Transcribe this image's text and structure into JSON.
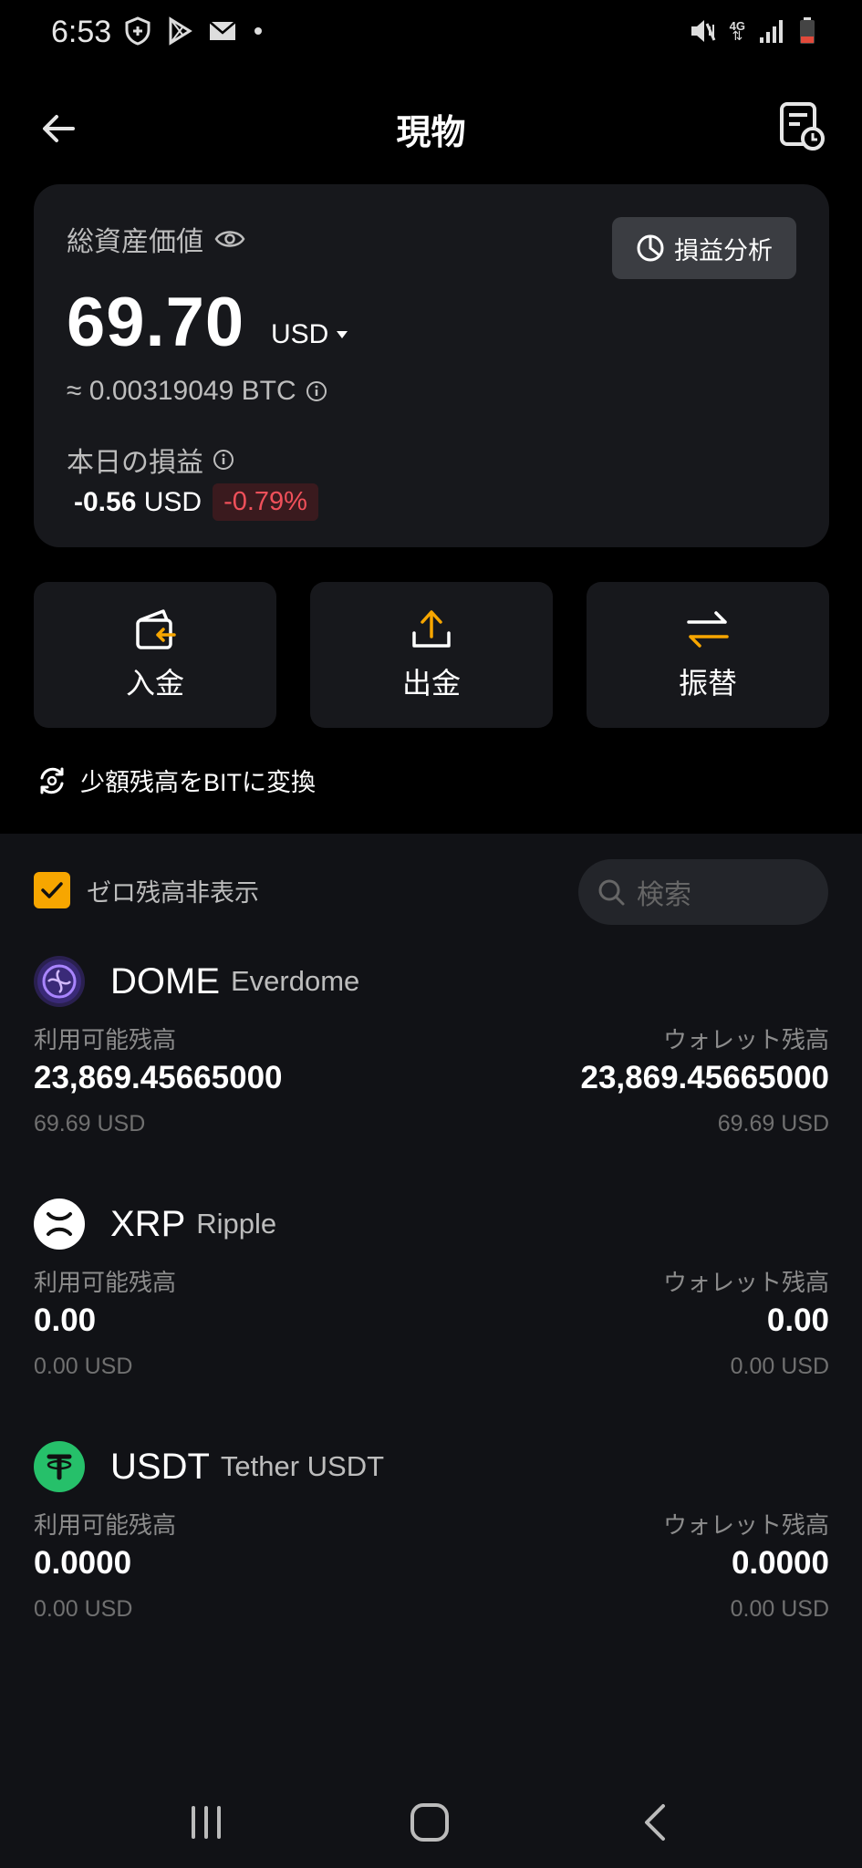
{
  "status": {
    "time": "6:53",
    "network": "4G"
  },
  "header": {
    "title": "現物"
  },
  "card": {
    "total_label": "総資産価値",
    "pnl_button": "損益分析",
    "amount": "69.70",
    "currency": "USD",
    "btc_equiv": "≈ 0.00319049 BTC",
    "today_label": "本日の損益",
    "today_value": "-0.56",
    "today_currency": "USD",
    "today_pct": "-0.79%"
  },
  "actions": {
    "deposit": "入金",
    "withdraw": "出金",
    "transfer": "振替"
  },
  "convert_label": "少額残高をBITに変換",
  "filter": {
    "hide_zero_label": "ゼロ残高非表示",
    "hide_zero_checked": true
  },
  "search": {
    "placeholder": "検索"
  },
  "coins": [
    {
      "symbol": "DOME",
      "name": "Everdome",
      "available_label": "利用可能残高",
      "wallet_label": "ウォレット残高",
      "available": "23,869.45665000",
      "available_usd": "69.69 USD",
      "wallet": "23,869.45665000",
      "wallet_usd": "69.69 USD"
    },
    {
      "symbol": "XRP",
      "name": "Ripple",
      "available_label": "利用可能残高",
      "wallet_label": "ウォレット残高",
      "available": "0.00",
      "available_usd": "0.00 USD",
      "wallet": "0.00",
      "wallet_usd": "0.00 USD"
    },
    {
      "symbol": "USDT",
      "name": "Tether USDT",
      "available_label": "利用可能残高",
      "wallet_label": "ウォレット残高",
      "available": "0.0000",
      "available_usd": "0.00 USD",
      "wallet": "0.0000",
      "wallet_usd": "0.00 USD"
    }
  ],
  "colors": {
    "accent": "#f7a600",
    "negative": "#f0505a",
    "usdt": "#26c06a"
  }
}
